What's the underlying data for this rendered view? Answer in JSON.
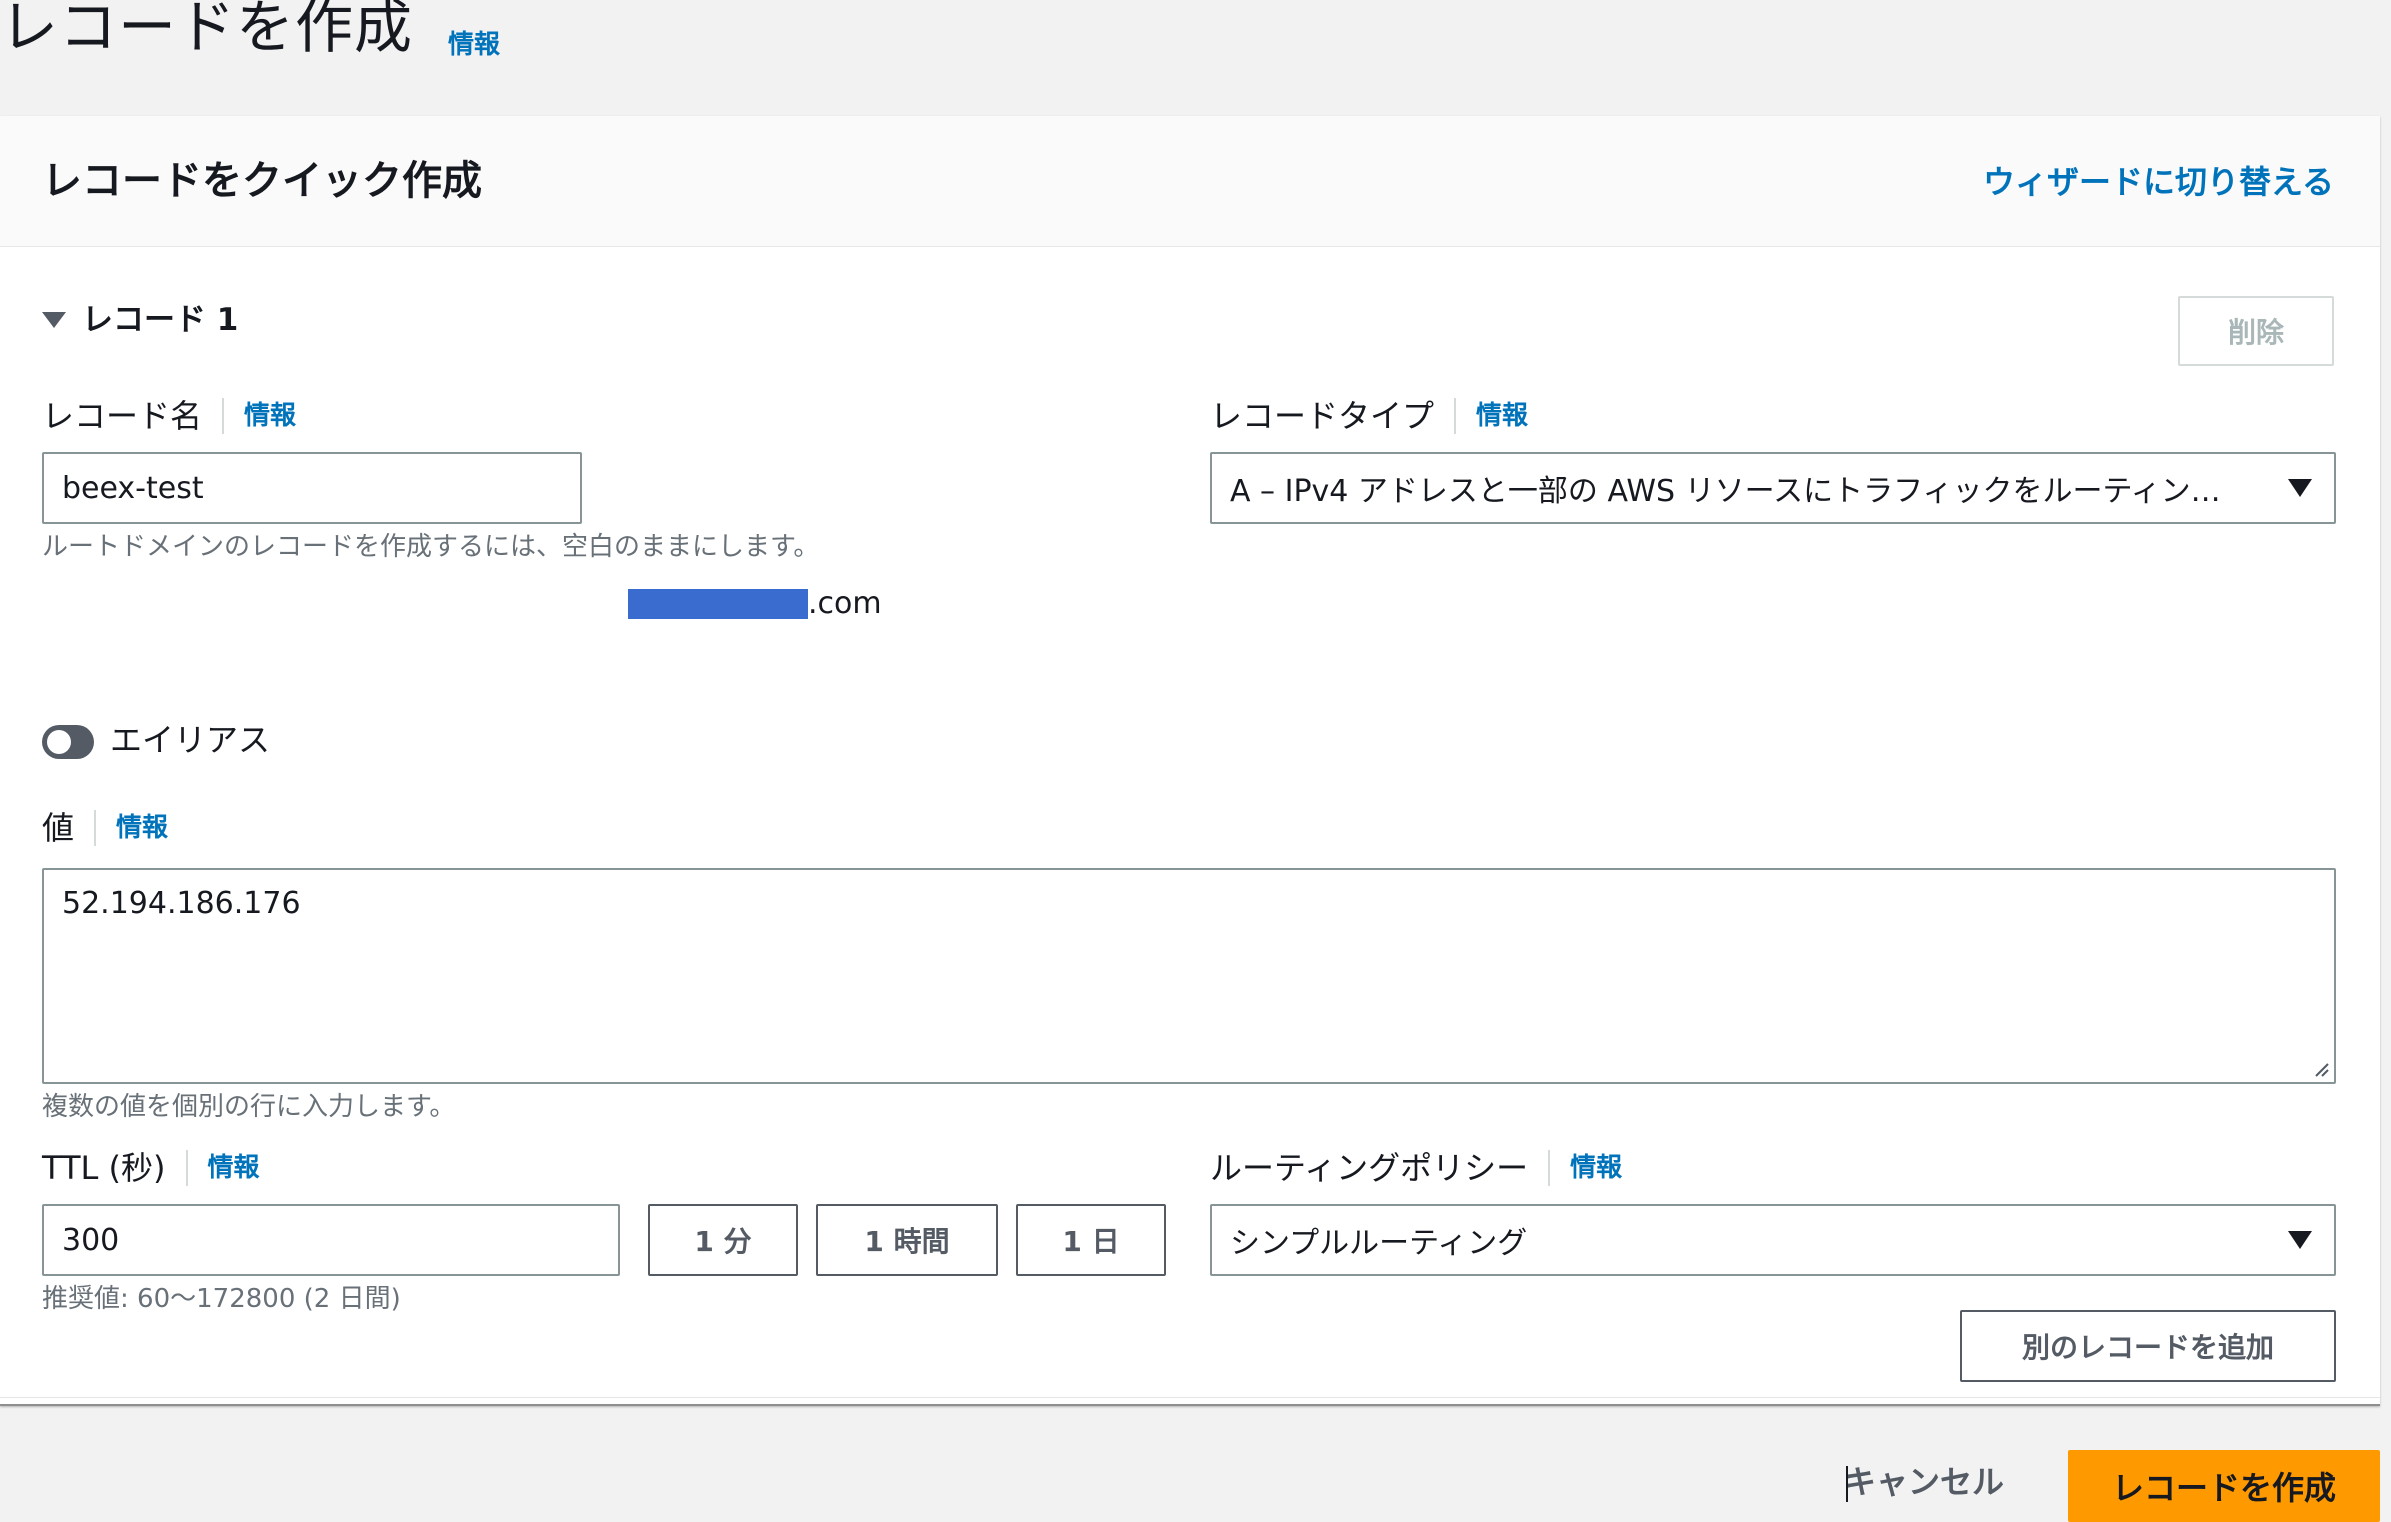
{
  "page": {
    "title": "レコードを作成",
    "info_link": "情報"
  },
  "panel": {
    "title": "レコードをクイック作成",
    "wizard_link": "ウィザードに切り替える"
  },
  "record": {
    "section_label": "レコード 1",
    "delete_label": "削除",
    "name": {
      "label": "レコード名",
      "info": "情報",
      "value": "beex-test",
      "domain_suffix": ".com",
      "hint": "ルートドメインのレコードを作成するには、空白のままにします。"
    },
    "type": {
      "label": "レコードタイプ",
      "info": "情報",
      "selected": "A – IPv4 アドレスと一部の AWS リソースにトラフィックをルーティン…"
    },
    "alias": {
      "label": "エイリアス",
      "enabled": false
    },
    "value": {
      "label": "値",
      "info": "情報",
      "text": "52.194.186.176",
      "hint": "複数の値を個別の行に入力します。"
    },
    "ttl": {
      "label": "TTL (秒)",
      "info": "情報",
      "value": "300",
      "preset_1": "1 分",
      "preset_2": "1 時間",
      "preset_3": "1 日",
      "hint": "推奨値: 60～172800 (2 日間)"
    },
    "routing": {
      "label": "ルーティングポリシー",
      "info": "情報",
      "selected": "シンプルルーティング"
    }
  },
  "add_record_label": "別のレコードを追加",
  "footer": {
    "cancel_label": "キャンセル",
    "create_label": "レコードを作成"
  },
  "colors": {
    "link": "#0073bb",
    "primary_button": "#ff9900",
    "toggle_off": "#545b64"
  }
}
